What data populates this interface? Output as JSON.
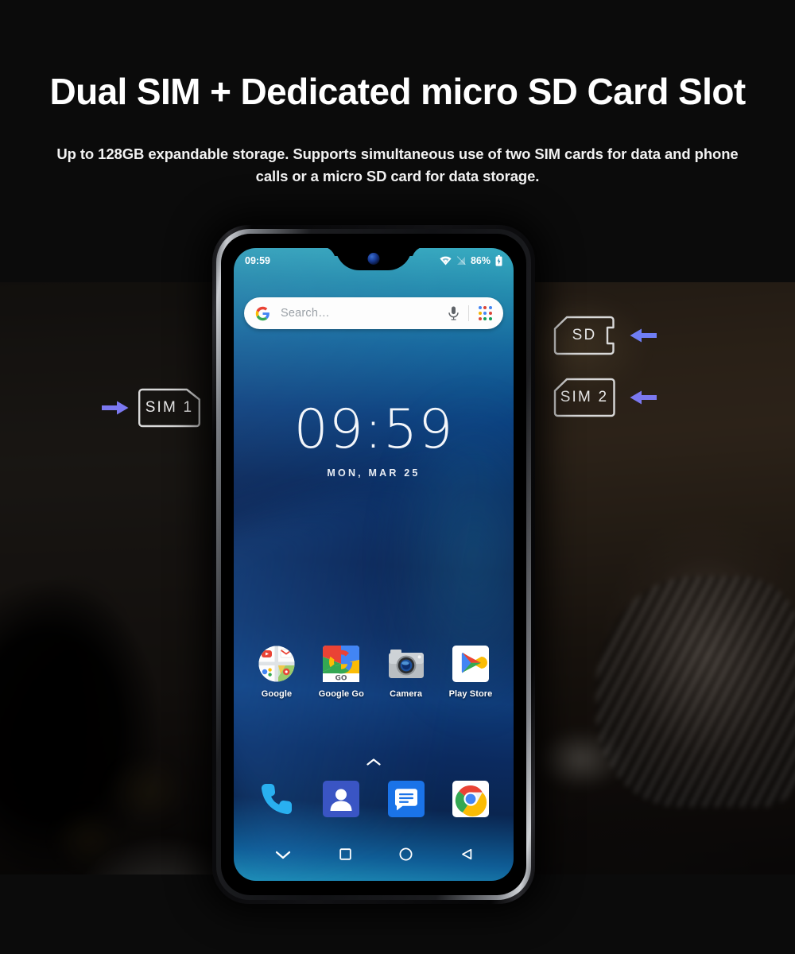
{
  "header": {
    "headline": "Dual SIM + Dedicated micro SD Card Slot",
    "subtext": "Up to 128GB expandable storage. Supports simultaneous use of two SIM cards for data and phone calls or a micro SD card for data storage."
  },
  "callouts": [
    {
      "id": "sim1",
      "label": "SIM 1",
      "arrow": "arrow-right-icon",
      "arrow_color": "#7b78f0"
    },
    {
      "id": "sd",
      "label": "SD",
      "arrow": "arrow-left-icon",
      "arrow_color": "#6f7ef5"
    },
    {
      "id": "sim2",
      "label": "SIM 2",
      "arrow": "arrow-left-icon",
      "arrow_color": "#7b78f0"
    }
  ],
  "phone": {
    "statusbar": {
      "time": "09:59",
      "battery_percent": "86%",
      "icons": [
        "wifi-icon",
        "no-signal-icon",
        "battery-icon"
      ]
    },
    "search": {
      "placeholder": "Search…",
      "logo": "google-g-icon",
      "mic": "microphone-icon",
      "apps_grid": "google-apps-grid-icon",
      "dot_colors": [
        "#4285f4",
        "#db4437",
        "#4285f4",
        "#f4b400",
        "#4285f4",
        "#db4437",
        "#db4437",
        "#0f9d58",
        "#0f9d58"
      ]
    },
    "clock": {
      "time": "09:59",
      "date": "MON, MAR 25"
    },
    "apps": [
      {
        "label": "Google",
        "icon": "google-folder-icon"
      },
      {
        "label": "Google Go",
        "icon": "google-go-icon"
      },
      {
        "label": "Camera",
        "icon": "camera-icon"
      },
      {
        "label": "Play Store",
        "icon": "play-store-icon"
      }
    ],
    "drawer_indicator": "chevron-up-icon",
    "dock": [
      {
        "label": "Phone",
        "icon": "phone-dialer-icon"
      },
      {
        "label": "Contacts",
        "icon": "contacts-icon"
      },
      {
        "label": "Messages",
        "icon": "messages-icon"
      },
      {
        "label": "Chrome",
        "icon": "chrome-icon"
      }
    ],
    "navbar": [
      "chevron-down-icon",
      "recents-square-icon",
      "home-circle-icon",
      "back-triangle-icon"
    ]
  },
  "colors": {
    "background": "#0b0b0b",
    "headline": "#ffffff",
    "accent_arrow": "#7b78f0",
    "card_outline": "#d9d9d9",
    "screen_top": "#2ba6bd",
    "screen_mid": "#0b2250"
  }
}
